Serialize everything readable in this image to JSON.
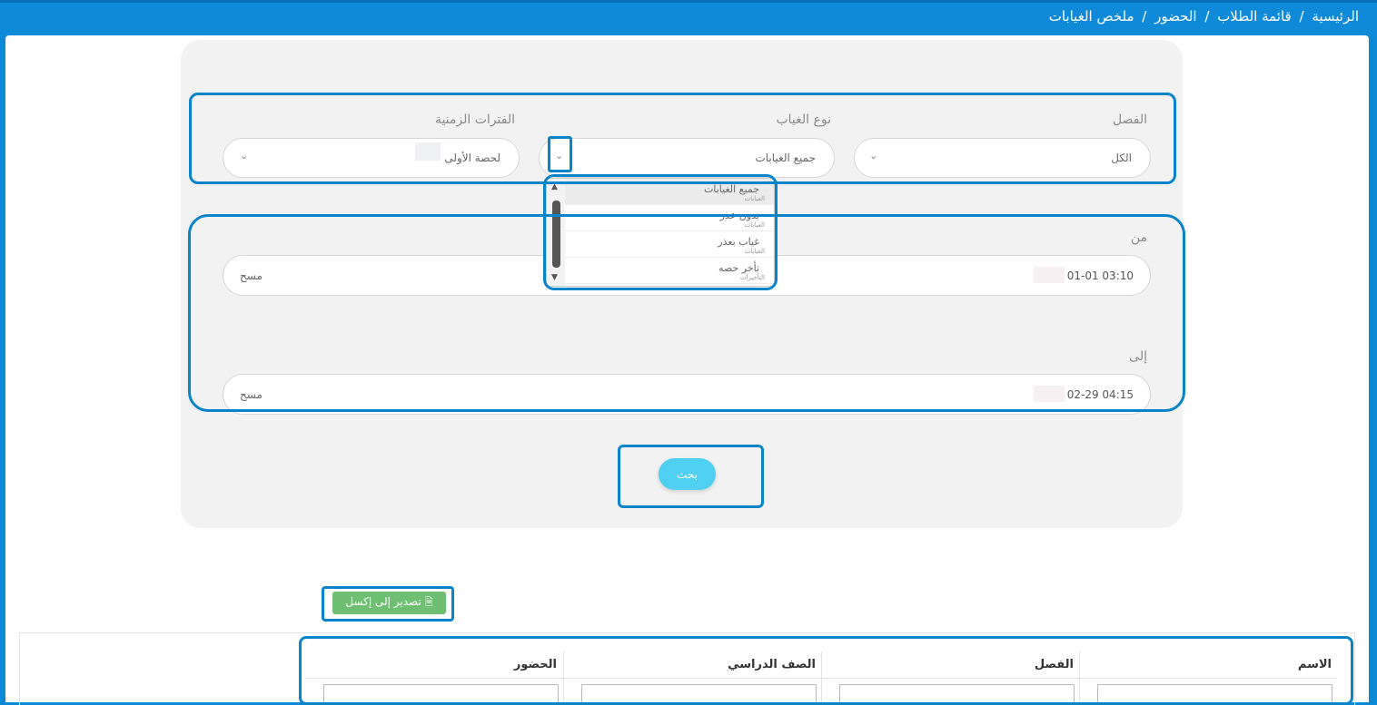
{
  "breadcrumb": [
    "الرئيسية",
    "قائمة الطلاب",
    "الحضور",
    "ملخص الغيابات"
  ],
  "breadcrumb_separator": "/",
  "filters": {
    "class": {
      "label": "الفصل",
      "value": "الكل"
    },
    "absence_type": {
      "label": "نوع الغياب",
      "value": "جميع الغيابات",
      "options": [
        {
          "label": "جميع الغيابات",
          "group": "الغيابات"
        },
        {
          "label": "بدون عذر",
          "group": "الغيابات"
        },
        {
          "label": "غياب بعذر",
          "group": "الغيابات"
        },
        {
          "label": "تأخر حصه",
          "group": "التأخيرات"
        }
      ]
    },
    "periods": {
      "label": "الفترات الزمنية",
      "value": "لحصة الأولى"
    }
  },
  "date_from": {
    "label": "من",
    "value": "01-01 03:10",
    "clear_label": "مسح"
  },
  "date_to": {
    "label": "إلى",
    "value": "02-29 04:15",
    "clear_label": "مسح"
  },
  "search_button": "بحث",
  "export_button": "تصدير إلى إكسل",
  "table": {
    "columns": [
      "الاسم",
      "الفصل",
      "الصف الدراسي",
      "الحضور"
    ]
  },
  "colors": {
    "header_blue": "#0e8ad8",
    "search_button": "#4fd0f0",
    "export_button": "#6fbf73",
    "highlight": "#0a84c9"
  }
}
